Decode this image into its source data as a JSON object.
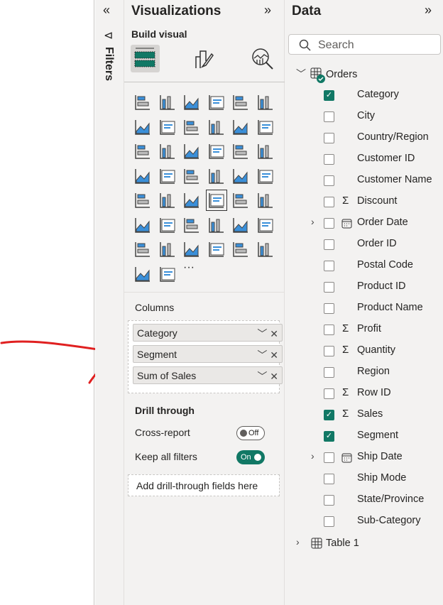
{
  "filters": {
    "label": "Filters",
    "collapse": "«"
  },
  "visualizations": {
    "title": "Visualizations",
    "expand": "»",
    "build_visual": "Build visual",
    "modes": [
      "build-visual",
      "format-visual",
      "analytics"
    ],
    "icons": [
      "stacked-bar",
      "stacked-column",
      "clustered-bar",
      "clustered-column",
      "100-stacked-bar",
      "100-stacked-column",
      "line",
      "area",
      "stacked-area",
      "100-stacked-area",
      "line-stacked-column",
      "line-clustered-column",
      "ribbon",
      "waterfall",
      "funnel",
      "scatter",
      "pie",
      "donut",
      "treemap",
      "map",
      "filled-map",
      "azure-map",
      "gauge",
      "card",
      "multi-row-card",
      "kpi",
      "slicer",
      "table",
      "matrix",
      "r-visual",
      "python-visual",
      "key-influencers",
      "decomposition-tree",
      "qa",
      "smart-narrative",
      "goals",
      "paginated-report",
      "card-new",
      "slicer-new",
      "text-slicer",
      "list-slicer",
      "arcgis-map",
      "power-apps",
      "power-automate"
    ],
    "more": "···",
    "columns_label": "Columns",
    "columns": [
      {
        "label": "Category"
      },
      {
        "label": "Segment"
      },
      {
        "label": "Sum of Sales"
      }
    ],
    "drill_through": "Drill through",
    "cross_report": {
      "label": "Cross-report",
      "state": "Off"
    },
    "keep_filters": {
      "label": "Keep all filters",
      "state": "On"
    },
    "drill_placeholder": "Add drill-through fields here"
  },
  "data": {
    "title": "Data",
    "expand": "»",
    "search_placeholder": "Search",
    "table": "Orders",
    "fields": [
      {
        "label": "Category",
        "checked": true
      },
      {
        "label": "City"
      },
      {
        "label": "Country/Region"
      },
      {
        "label": "Customer ID"
      },
      {
        "label": "Customer Name"
      },
      {
        "label": "Discount",
        "sigma": true
      },
      {
        "label": "Order Date",
        "date": true
      },
      {
        "label": "Order ID"
      },
      {
        "label": "Postal Code"
      },
      {
        "label": "Product ID"
      },
      {
        "label": "Product Name"
      },
      {
        "label": "Profit",
        "sigma": true
      },
      {
        "label": "Quantity",
        "sigma": true
      },
      {
        "label": "Region"
      },
      {
        "label": "Row ID",
        "sigma": true
      },
      {
        "label": "Sales",
        "sigma": true,
        "checked": true
      },
      {
        "label": "Segment",
        "checked": true
      },
      {
        "label": "Ship Date",
        "date": true
      },
      {
        "label": "Ship Mode"
      },
      {
        "label": "State/Province"
      },
      {
        "label": "Sub-Category"
      }
    ],
    "table2": "Table 1"
  },
  "colors": {
    "accent": "#117865",
    "annotation": "#e02020",
    "blue": "#3a8fd9"
  }
}
